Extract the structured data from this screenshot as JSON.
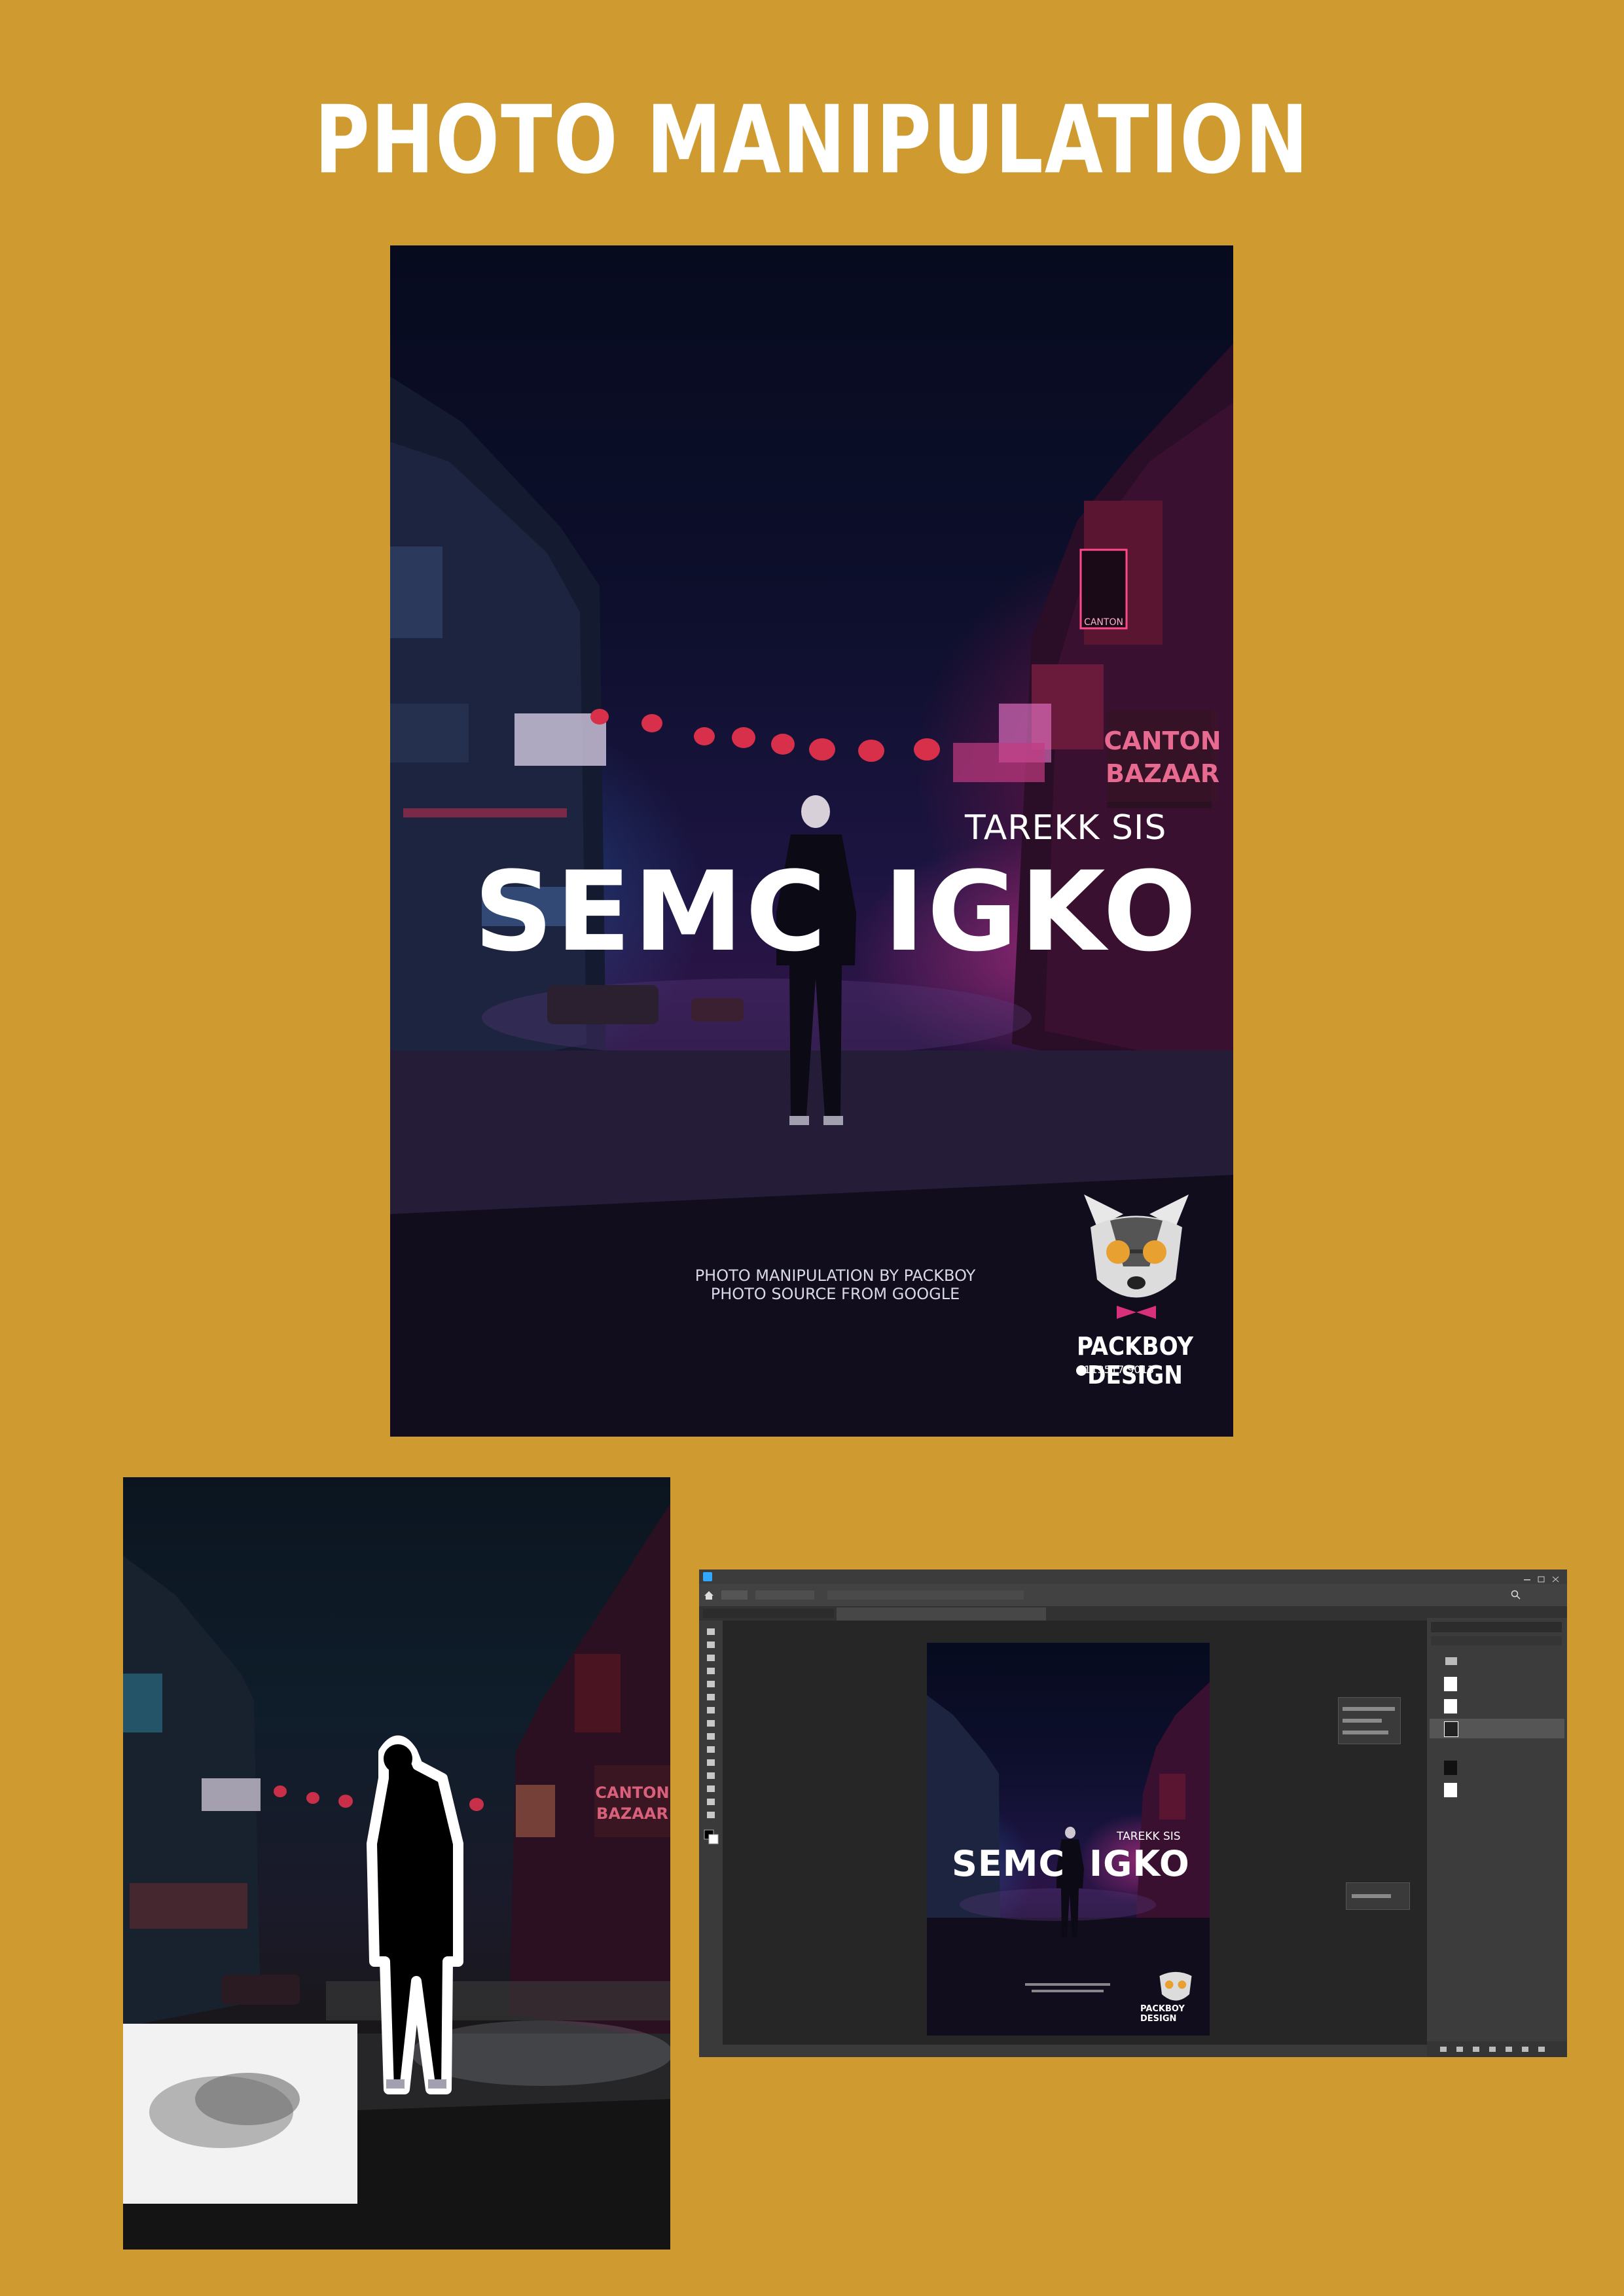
{
  "page": {
    "title": "PHOTO MANIPULATION",
    "background_color": "#cf9a30"
  },
  "poster": {
    "author": "TAREKK SIS",
    "title_left": "SEMC",
    "title_right": "IGKO",
    "credit_line_1": "PHOTO MANIPULATION BY PACKBOY",
    "credit_line_2": "PHOTO SOURCE FROM GOOGLE",
    "brand": "PACKBOY DESIGN",
    "phone": "0113517 9013",
    "sign_canton": "CANTON",
    "sign_bazaar": "BAZAAR"
  },
  "process": {
    "sign_canton": "CANTON",
    "sign_bazaar": "BAZAAR"
  },
  "photoshop": {
    "accent": "#31a8ff",
    "doc_author": "TAREKK SIS",
    "doc_title_left": "SEMC",
    "doc_title_right": "IGKO",
    "doc_brand": "PACKBOY DESIGN"
  }
}
